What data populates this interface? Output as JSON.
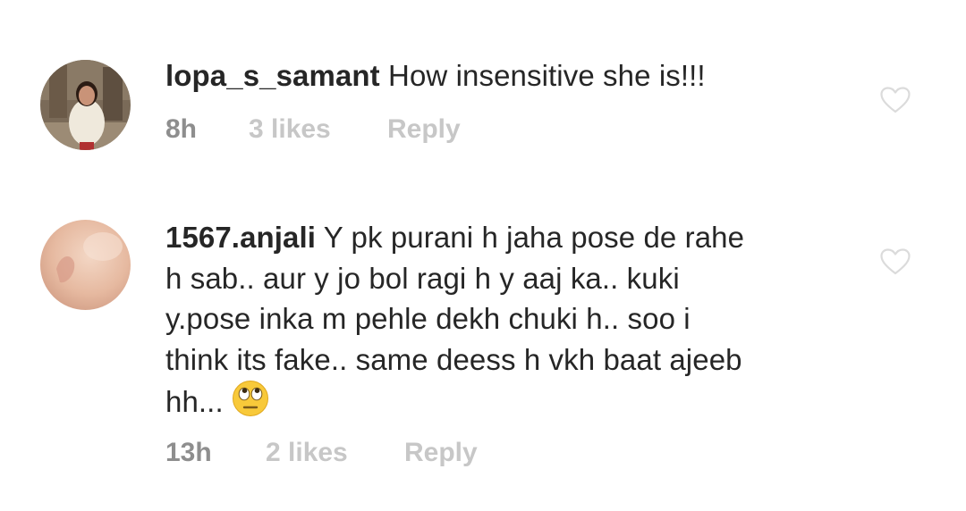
{
  "comments": [
    {
      "username": "lopa_s_samant",
      "text": "How insensitive she is!!!",
      "time": "8h",
      "likes": "3 likes",
      "reply": "Reply"
    },
    {
      "username": "1567.anjali",
      "text_lines": [
        "Y pk purani h jaha pose de rahe",
        "h sab.. aur y jo bol ragi h y aaj ka.. kuki",
        "y.pose inka m pehle dekh chuki h.. soo i",
        "think its fake.. same deess h vkh baat ajeeb",
        "hh..."
      ],
      "time": "13h",
      "likes": "2 likes",
      "reply": "Reply"
    }
  ],
  "icons": {
    "like": "heart-outline-icon",
    "emoji": "face-with-rolling-eyes"
  },
  "colors": {
    "text": "#262626",
    "meta_time": "#8e8e8e",
    "meta_secondary": "#c7c7c7",
    "heart_outline": "#dbdbdb"
  }
}
